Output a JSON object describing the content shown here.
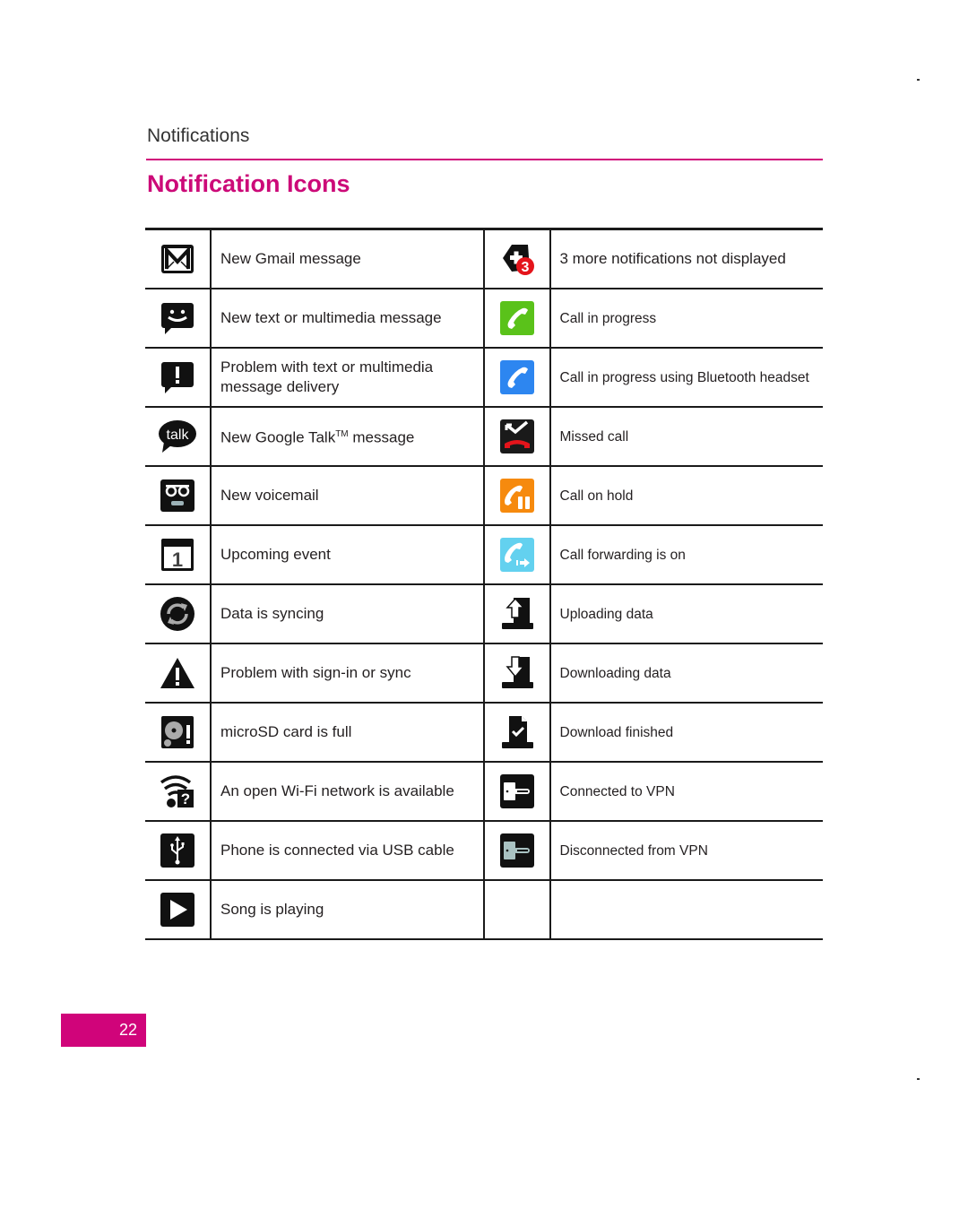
{
  "header": {
    "section_label": "Notifications",
    "page_title": "Notification Icons"
  },
  "rows": [
    {
      "left": {
        "icon": "gmail-icon",
        "text": "New Gmail message"
      },
      "right": {
        "icon": "more-notifications-icon",
        "badge": "3",
        "text": "3 more notifications not displayed"
      }
    },
    {
      "left": {
        "icon": "text-message-icon",
        "text": "New text or multimedia message"
      },
      "right": {
        "icon": "call-in-progress-icon",
        "text": "Call in progress"
      }
    },
    {
      "left": {
        "icon": "message-error-icon",
        "text": "Problem with text or multimedia message delivery"
      },
      "right": {
        "icon": "bluetooth-call-icon",
        "text": "Call in progress using Bluetooth headset"
      }
    },
    {
      "left": {
        "icon": "google-talk-icon",
        "icon_text": "talk",
        "text_pre": "New Google Talk",
        "text_sup": "TM",
        "text_post": " message"
      },
      "right": {
        "icon": "missed-call-icon",
        "text": "Missed call"
      }
    },
    {
      "left": {
        "icon": "voicemail-icon",
        "text": "New voicemail"
      },
      "right": {
        "icon": "call-on-hold-icon",
        "text": "Call on hold"
      }
    },
    {
      "left": {
        "icon": "calendar-icon",
        "icon_text": "1",
        "text": "Upcoming event"
      },
      "right": {
        "icon": "call-forwarding-icon",
        "text": "Call forwarding is on"
      }
    },
    {
      "left": {
        "icon": "sync-icon",
        "text": "Data is syncing"
      },
      "right": {
        "icon": "upload-icon",
        "text": "Uploading data"
      }
    },
    {
      "left": {
        "icon": "warning-icon",
        "text": "Problem with sign-in or sync"
      },
      "right": {
        "icon": "download-icon",
        "text": "Downloading data"
      }
    },
    {
      "left": {
        "icon": "sd-card-full-icon",
        "text": "microSD card is full"
      },
      "right": {
        "icon": "download-finished-icon",
        "text": "Download finished"
      }
    },
    {
      "left": {
        "icon": "open-wifi-icon",
        "text": "An open Wi-Fi network is available"
      },
      "right": {
        "icon": "vpn-connected-icon",
        "text": "Connected to VPN"
      }
    },
    {
      "left": {
        "icon": "usb-icon",
        "text": "Phone is connected via USB cable"
      },
      "right": {
        "icon": "vpn-disconnected-icon",
        "text": "Disconnected from VPN"
      }
    },
    {
      "left": {
        "icon": "play-icon",
        "text": "Song is playing"
      },
      "right": {
        "icon": "",
        "text": ""
      }
    }
  ],
  "colors": {
    "accent": "#cc0a78",
    "call_green": "#5ac21a",
    "call_blue": "#2d86f0",
    "hold_orange": "#f68a0e",
    "forward_cyan": "#63d1ef",
    "badge_red": "#e4141b"
  },
  "footer": {
    "page_number": "22"
  }
}
